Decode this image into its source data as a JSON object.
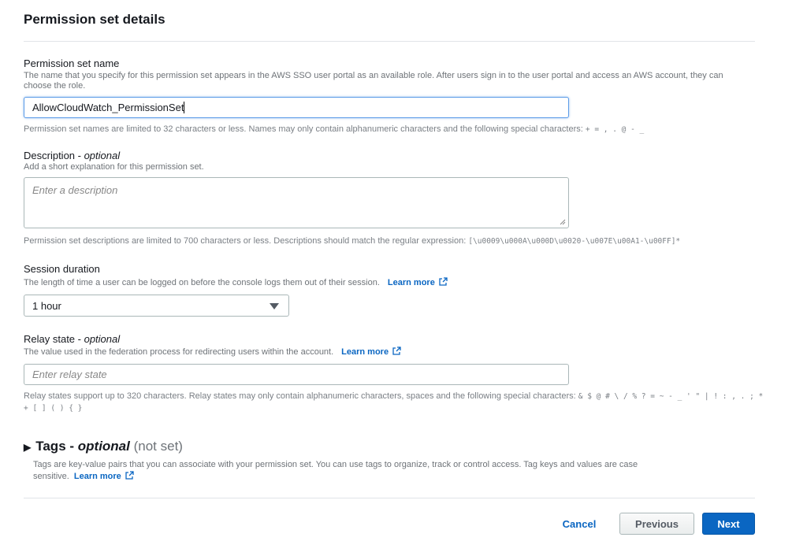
{
  "page_title": "Permission set details",
  "name_field": {
    "label": "Permission set name",
    "help": "The name that you specify for this permission set appears in the AWS SSO user portal as an available role. After users sign in to the user portal and access an AWS account, they can choose the role.",
    "value": "AllowCloudWatch_PermissionSet",
    "constraint_text": "Permission set names are limited to 32 characters or less. Names may only contain alphanumeric characters and the following special characters:",
    "constraint_chars": "+ = , . @ - _"
  },
  "description_field": {
    "label": "Description - ",
    "label_optional": "optional",
    "help": "Add a short explanation for this permission set.",
    "placeholder": "Enter a description",
    "constraint_text": "Permission set descriptions are limited to 700 characters or less. Descriptions should match the regular expression:",
    "constraint_regex": "[\\u0009\\u000A\\u000D\\u0020-\\u007E\\u00A1-\\u00FF]*"
  },
  "session_duration": {
    "label": "Session duration",
    "help": "The length of time a user can be logged on before the console logs them out of their session.",
    "learn_more": "Learn more",
    "selected": "1 hour"
  },
  "relay_state": {
    "label": "Relay state - ",
    "label_optional": "optional",
    "help": "The value used in the federation process for redirecting users within the account.",
    "learn_more": "Learn more",
    "placeholder": "Enter relay state",
    "constraint_text": "Relay states support up to 320 characters. Relay states may only contain alphanumeric characters, spaces and the following special characters:",
    "constraint_chars": "& $ @ # \\ / % ? = ~ - _ ' \" | ! : , . ; * + [ ] ( ) { }"
  },
  "tags": {
    "title": "Tags - ",
    "optional": "optional",
    "status": "(not set)",
    "description": "Tags are key-value pairs that you can associate with your permission set. You can use tags to organize, track or control access. Tag keys and values are case sensitive.",
    "learn_more": "Learn more"
  },
  "actions": {
    "cancel": "Cancel",
    "previous": "Previous",
    "next": "Next"
  },
  "colors": {
    "primary": "#0a66c2",
    "link": "#0a66c2",
    "focus_border": "#5a9be8"
  }
}
